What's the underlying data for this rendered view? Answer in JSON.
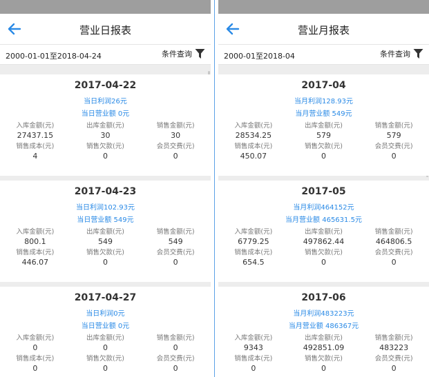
{
  "daily": {
    "title": "营业日报表",
    "date_range": "2000-01-01至2018-04-24",
    "filter_label": "条件查询",
    "labels": [
      "入库金额(元)",
      "出库金额(元)",
      "销售金额(元)",
      "销售成本(元)",
      "销售欠款(元)",
      "会员交费(元)"
    ],
    "cards": [
      {
        "date": "2017-04-22",
        "profit": "当日利润26元",
        "revenue": "当日营业额 0元",
        "values": [
          "27437.15",
          "30",
          "30",
          "4",
          "0",
          "0"
        ]
      },
      {
        "date": "2017-04-23",
        "profit": "当日利润102.93元",
        "revenue": "当日营业额 549元",
        "values": [
          "800.1",
          "549",
          "549",
          "446.07",
          "0",
          "0"
        ]
      },
      {
        "date": "2017-04-27",
        "profit": "当日利润0元",
        "revenue": "当日营业额 0元",
        "values": [
          "0",
          "0",
          "0",
          "0",
          "0",
          "0"
        ]
      }
    ]
  },
  "monthly": {
    "title": "营业月报表",
    "date_range": "2000-01至2018-04",
    "filter_label": "条件查询",
    "labels": [
      "入库金额(元)",
      "出库金额(元)",
      "销售金额(元)",
      "销售成本(元)",
      "销售欠款(元)",
      "会员交费(元)"
    ],
    "cards": [
      {
        "date": "2017-04",
        "profit": "当月利润128.93元",
        "revenue": "当月营业额 549元",
        "values": [
          "28534.25",
          "579",
          "579",
          "450.07",
          "0",
          "0"
        ]
      },
      {
        "date": "2017-05",
        "profit": "当月利润464152元",
        "revenue": "当月营业额 465631.5元",
        "values": [
          "6779.25",
          "497862.44",
          "464806.5",
          "654.5",
          "0",
          "0"
        ]
      },
      {
        "date": "2017-06",
        "profit": "当月利润483223元",
        "revenue": "当月营业额 486367元",
        "values": [
          "9343",
          "492851.09",
          "483223",
          "0",
          "0",
          "0"
        ]
      }
    ]
  },
  "colors": {
    "accent": "#2a8ae6",
    "statusbar": "#9e9e9e",
    "background": "#ededed"
  },
  "icons": {
    "back": "arrow-left-icon",
    "filter": "funnel-icon"
  }
}
